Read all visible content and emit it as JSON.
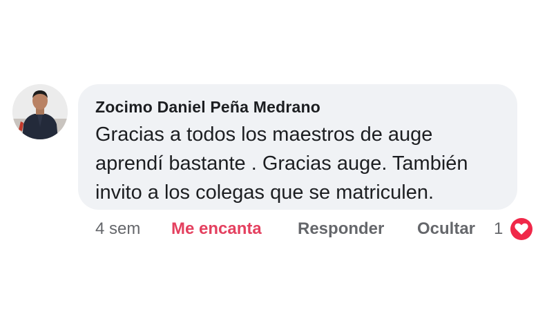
{
  "comment": {
    "author": "Zocimo Daniel Peña Medrano",
    "text": "Gracias a todos los maestros de auge\naprendí  bastante . Gracias auge. También\ninvito a los colegas que se matriculen.",
    "avatar_icon": "profile-photo",
    "actions": {
      "time": "4 sem",
      "reaction_label": "Me encanta",
      "reply_label": "Responder",
      "hide_label": "Ocultar",
      "reaction_count": "1",
      "reaction_icon": "heart-icon"
    },
    "colors": {
      "bubble": "#f0f2f5",
      "love_text": "#e4405f",
      "heart_badge": "#f02849",
      "secondary_text": "#65676b"
    }
  }
}
